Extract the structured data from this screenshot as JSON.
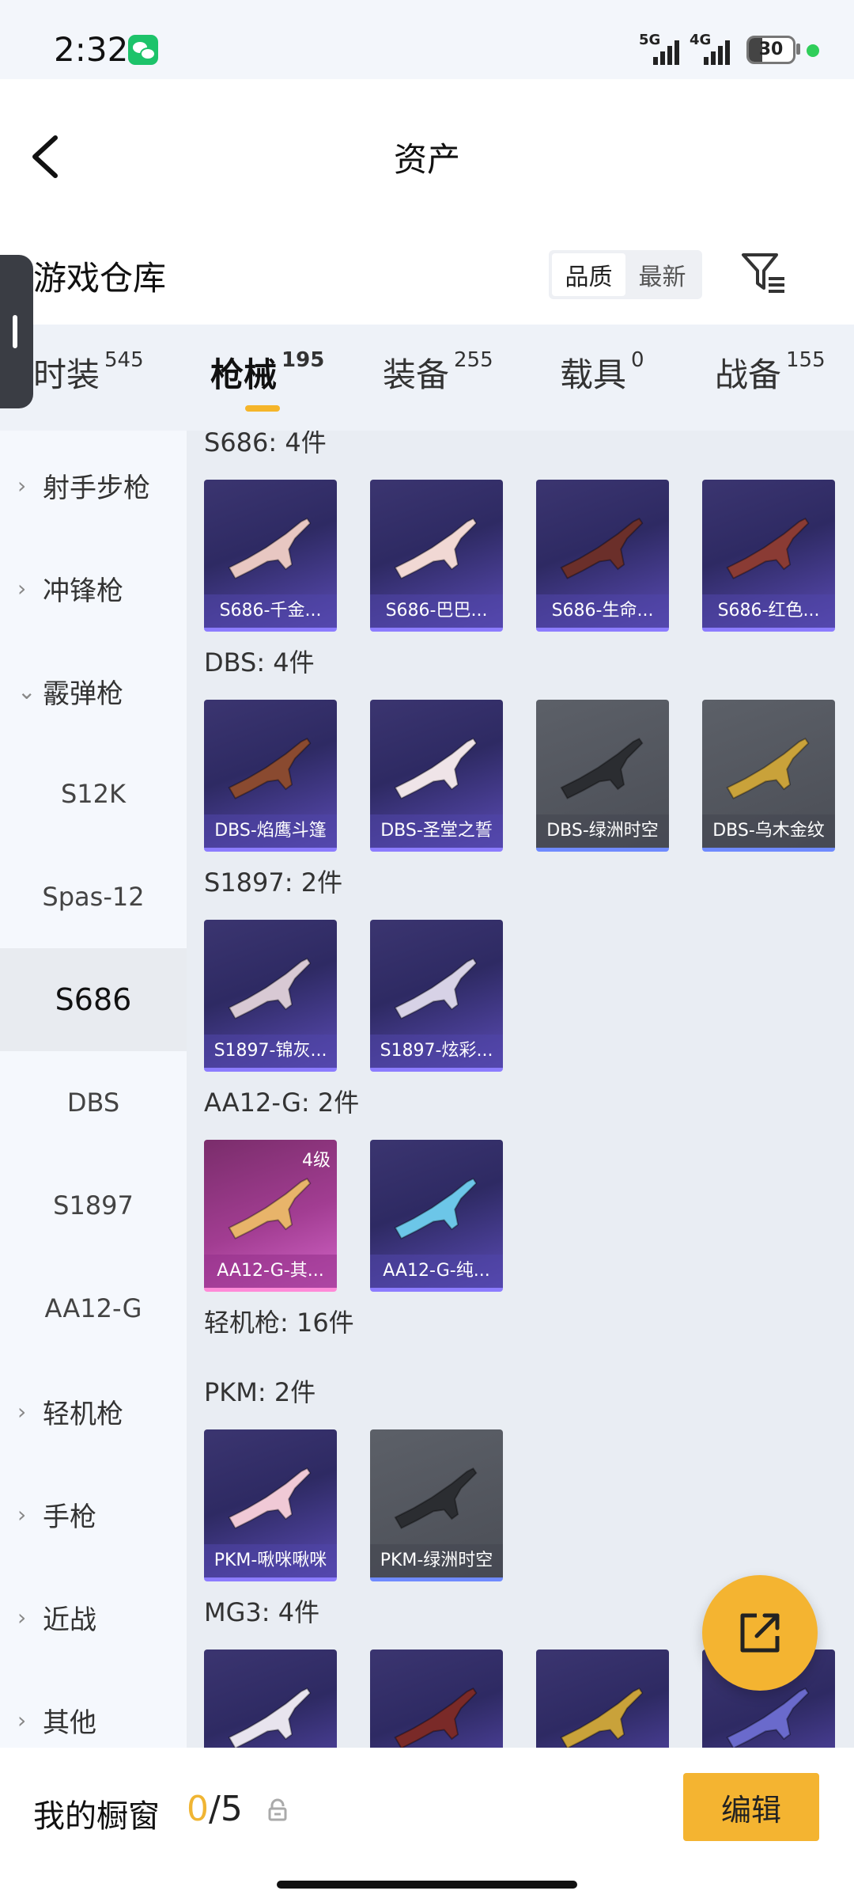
{
  "status_bar": {
    "time": "2:32",
    "net1": "5G",
    "net2": "4G",
    "battery": "30"
  },
  "header": {
    "title": "资产"
  },
  "section": {
    "title": "游戏仓库",
    "sort": [
      "品质",
      "最新"
    ]
  },
  "tabs": [
    {
      "label": "时装",
      "count": "545"
    },
    {
      "label": "枪械",
      "count": "195"
    },
    {
      "label": "装备",
      "count": "255"
    },
    {
      "label": "载具",
      "count": "0"
    },
    {
      "label": "战备",
      "count": "155"
    }
  ],
  "sidebar": {
    "items": [
      {
        "label": "射手步枪",
        "type": "cat",
        "chev": ">"
      },
      {
        "label": "冲锋枪",
        "type": "cat",
        "chev": ">"
      },
      {
        "label": "霰弹枪",
        "type": "cat",
        "chev": "v"
      },
      {
        "label": "S12K",
        "type": "sub"
      },
      {
        "label": "Spas-12",
        "type": "sub"
      },
      {
        "label": "S686",
        "type": "sub",
        "selected": true
      },
      {
        "label": "DBS",
        "type": "sub"
      },
      {
        "label": "S1897",
        "type": "sub"
      },
      {
        "label": "AA12-G",
        "type": "sub"
      },
      {
        "label": "轻机枪",
        "type": "cat",
        "chev": ">"
      },
      {
        "label": "手枪",
        "type": "cat",
        "chev": ">"
      },
      {
        "label": "近战",
        "type": "cat",
        "chev": ">"
      },
      {
        "label": "其他",
        "type": "cat",
        "chev": ">"
      }
    ]
  },
  "groups": [
    {
      "title": "S686: 4件",
      "cards": [
        {
          "name": "S686-千金...",
          "style": "purple",
          "gun_color": "#e8c7c2"
        },
        {
          "name": "S686-巴巴...",
          "style": "purple",
          "gun_color": "#f1d8d4"
        },
        {
          "name": "S686-生命...",
          "style": "purple",
          "gun_color": "#6b2f2a"
        },
        {
          "name": "S686-红色...",
          "style": "purple",
          "gun_color": "#8a3b34"
        }
      ]
    },
    {
      "title": "DBS: 4件",
      "cards": [
        {
          "name": "DBS-焰鹰斗篷",
          "style": "purple",
          "gun_color": "#8a4a30"
        },
        {
          "name": "DBS-圣堂之誓",
          "style": "purple",
          "gun_color": "#efe4e8"
        },
        {
          "name": "DBS-绿洲时空",
          "style": "gray",
          "gun_color": "#2b2d31"
        },
        {
          "name": "DBS-乌木金纹",
          "style": "gray",
          "gun_color": "#c9a23a"
        }
      ]
    },
    {
      "title": "S1897: 2件",
      "cards": [
        {
          "name": "S1897-锦灰...",
          "style": "purple",
          "gun_color": "#d8c9d4"
        },
        {
          "name": "S1897-炫彩...",
          "style": "purple",
          "gun_color": "#d7d2e6"
        }
      ]
    },
    {
      "title": "AA12-G: 2件",
      "cards": [
        {
          "name": "AA12-G-其...",
          "style": "pink",
          "gun_color": "#e8b46a",
          "level": "4级"
        },
        {
          "name": "AA12-G-纯...",
          "style": "purple",
          "gun_color": "#6cc6e8"
        }
      ]
    },
    {
      "title": "轻机枪: 16件",
      "cards": []
    },
    {
      "title": "PKM: 2件",
      "cards": [
        {
          "name": "PKM-啾咪啾咪",
          "style": "purple",
          "gun_color": "#f0c9d6"
        },
        {
          "name": "PKM-绿洲时空",
          "style": "gray",
          "gun_color": "#2b2d31"
        }
      ]
    },
    {
      "title": "MG3: 4件",
      "cards": [
        {
          "name": "",
          "style": "purple",
          "gun_color": "#e8e4ee"
        },
        {
          "name": "",
          "style": "purple",
          "gun_color": "#7a2a28"
        },
        {
          "name": "",
          "style": "purple",
          "gun_color": "#c9a23a"
        },
        {
          "name": "",
          "style": "purple",
          "gun_color": "#6a6acc"
        }
      ]
    }
  ],
  "bottom": {
    "label": "我的橱窗",
    "count_current": "0",
    "count_sep": "/5",
    "edit_label": "编辑"
  },
  "colors": {
    "accent": "#f4b431",
    "card_purple": "#2e2a63",
    "card_gray": "#4b4e56",
    "card_pink": "#a23d92"
  }
}
